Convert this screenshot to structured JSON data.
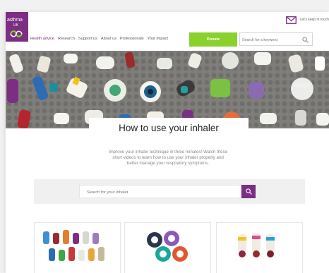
{
  "header": {
    "logo_line1": "asthma",
    "logo_line2": "UK",
    "keep_in_touch": "Let's keep in touch",
    "nav": [
      "Health advice",
      "Research",
      "Support us",
      "About us",
      "Professionals",
      "Your impact"
    ],
    "donate_label": "Donate",
    "search_placeholder": "Search for a keyword"
  },
  "main": {
    "title": "How to use your inhaler",
    "intro_line1": "Improve your inhaler technique in three minutes! Watch these",
    "intro_line2": "short videos to learn how to use your inhaler properly and",
    "intro_line3": "better manage your respiratory symptoms.",
    "inhaler_search_placeholder": "Search for your inhaler"
  },
  "colors": {
    "brand_purple": "#7b2e83",
    "donate_green": "#8bd12e",
    "hero_bg": "#7f7e7a"
  }
}
